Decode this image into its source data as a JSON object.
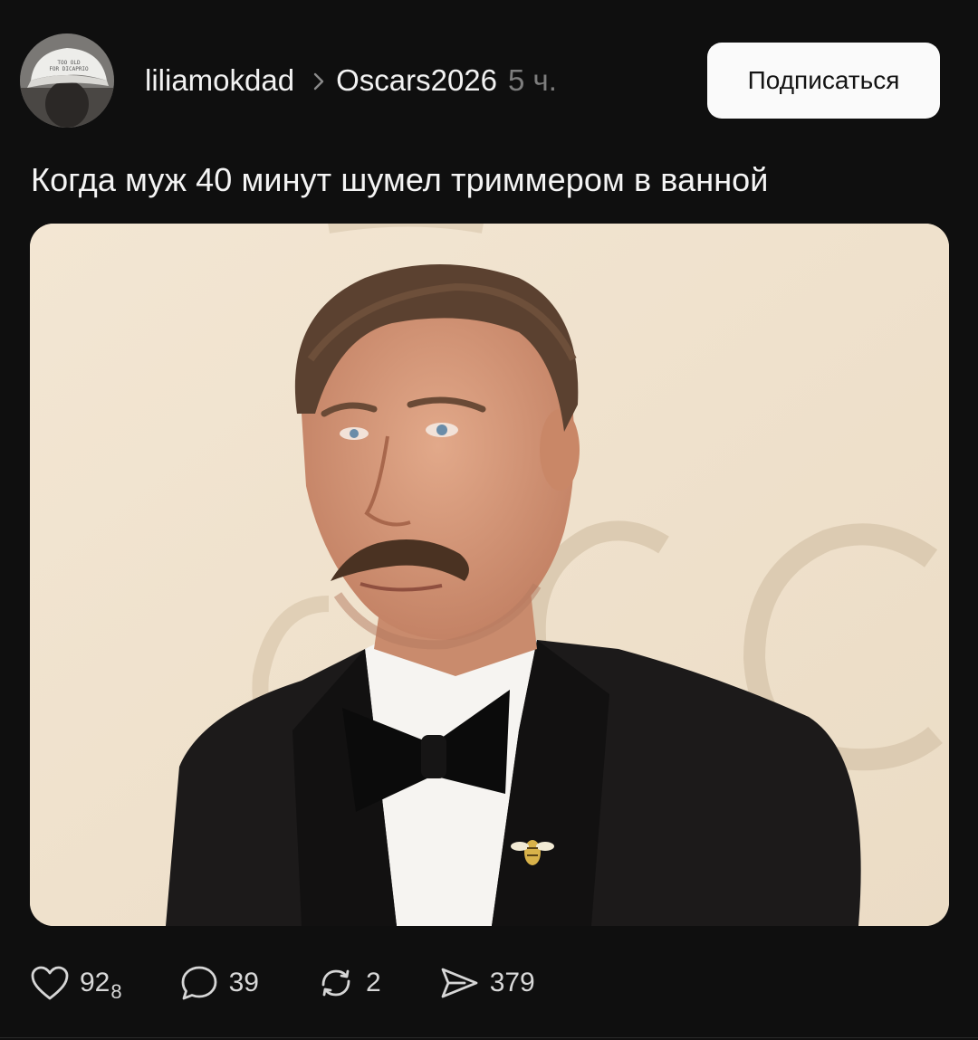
{
  "post": {
    "author": {
      "username": "liliamokdad",
      "avatar_cap_text": "TOO OLD FOR DICAPRIO"
    },
    "community": "Oscars2026",
    "time_ago": "5 ч.",
    "subscribe_label": "Подписаться",
    "caption": "Когда муж 40 минут шумел триммером в ванной",
    "image": {
      "alt": "Мужчина в смокинге с бабочкой и брошью-пчелой на фоне стены с логотипом Oscars"
    },
    "stats": {
      "likes_main": "92",
      "likes_sub": "8",
      "comments": "39",
      "reposts": "2",
      "shares": "379"
    }
  },
  "icons": {
    "like": "heart-icon",
    "comment": "comment-bubble-icon",
    "repost": "repost-icon",
    "share": "send-icon",
    "separator": "chevron-right-icon"
  },
  "colors": {
    "background": "#0f0f0f",
    "text": "#f3f3f3",
    "muted": "#7d7d7d",
    "button_bg": "#fafafa"
  }
}
